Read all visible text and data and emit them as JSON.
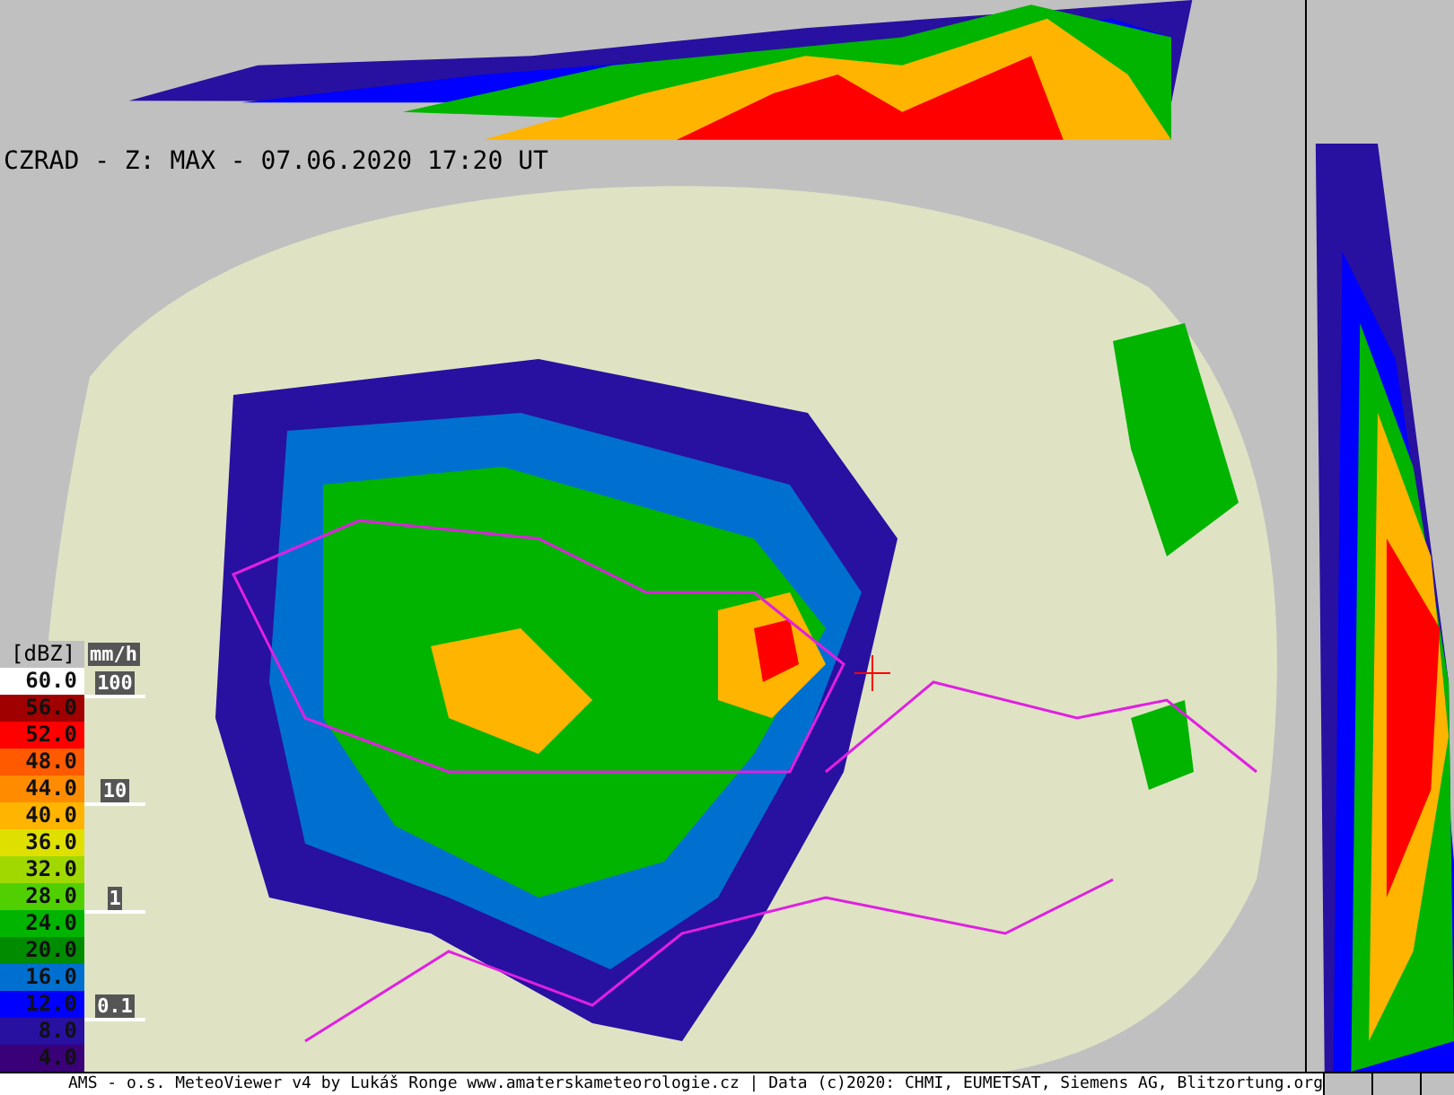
{
  "title": "CZRAD - Z: MAX - 07.06.2020 17:20 UT",
  "legend": {
    "unit": "[dBZ]",
    "entries": [
      {
        "label": "60.0",
        "color": "#ffffff"
      },
      {
        "label": "56.0",
        "color": "#a00000"
      },
      {
        "label": "52.0",
        "color": "#ff0000"
      },
      {
        "label": "48.0",
        "color": "#ff5a00"
      },
      {
        "label": "44.0",
        "color": "#ff8c00"
      },
      {
        "label": "40.0",
        "color": "#ffb400"
      },
      {
        "label": "36.0",
        "color": "#e0e000"
      },
      {
        "label": "32.0",
        "color": "#a0d800"
      },
      {
        "label": "28.0",
        "color": "#50d000"
      },
      {
        "label": "24.0",
        "color": "#00b400"
      },
      {
        "label": "20.0",
        "color": "#008c00"
      },
      {
        "label": "16.0",
        "color": "#0070d0"
      },
      {
        "label": "12.0",
        "color": "#0000ff"
      },
      {
        "label": "8.0",
        "color": "#2810a0"
      },
      {
        "label": "4.0",
        "color": "#3a0078"
      }
    ]
  },
  "rain_scale": {
    "unit": "mm/h",
    "ticks": [
      "100",
      "10",
      "1",
      "0.1"
    ]
  },
  "footer": "AMS - o.s. MeteoViewer v4 by Lukáš Ronge www.amaterskameteorologie.cz | Data (c)2020: CHMI, EUMETSAT, Siemens AG, Blitzortung.org"
}
